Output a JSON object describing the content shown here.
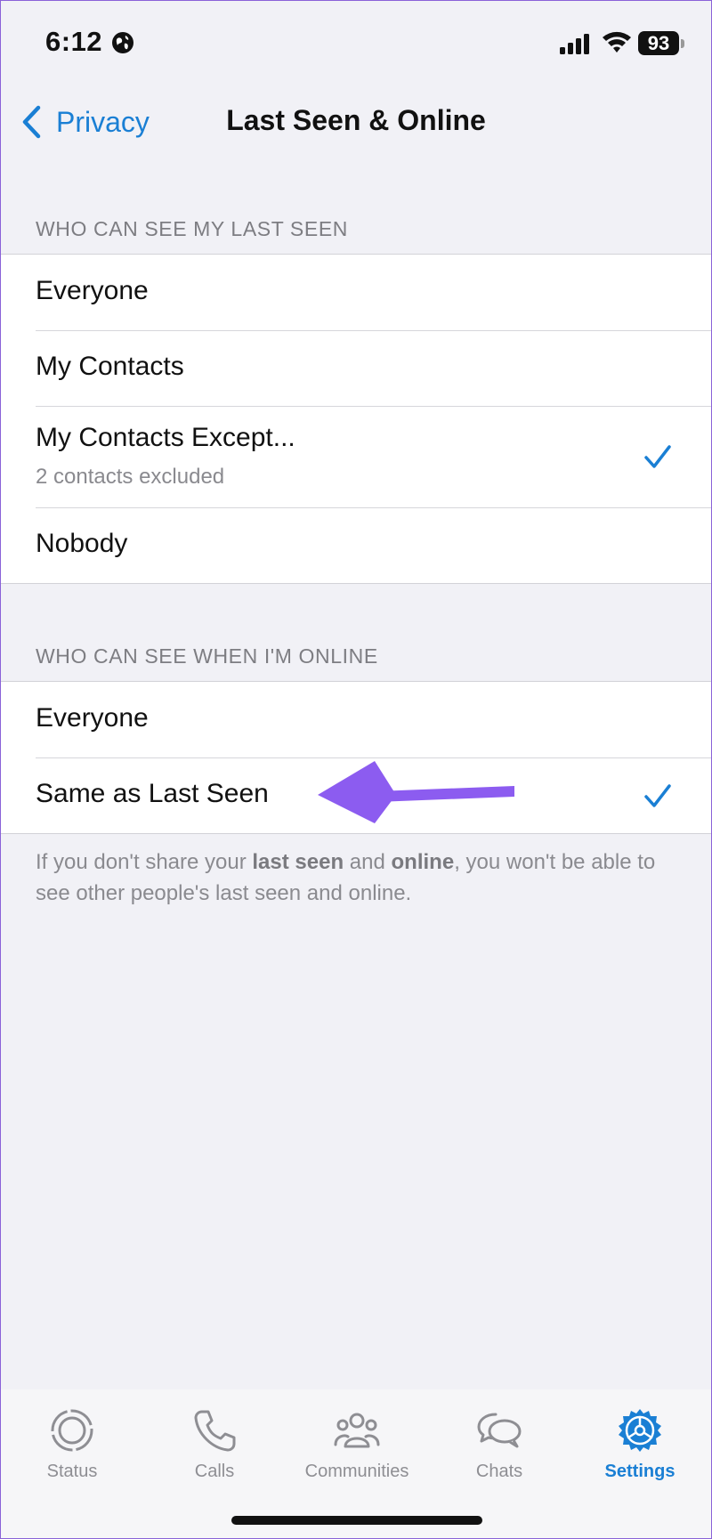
{
  "status_bar": {
    "time": "6:12",
    "battery": "93"
  },
  "nav": {
    "back_label": "Privacy",
    "title": "Last Seen & Online"
  },
  "last_seen": {
    "header": "WHO CAN SEE MY LAST SEEN",
    "options": [
      {
        "label": "Everyone",
        "selected": false
      },
      {
        "label": "My Contacts",
        "selected": false
      },
      {
        "label": "My Contacts Except...",
        "subtitle": "2 contacts excluded",
        "selected": true
      },
      {
        "label": "Nobody",
        "selected": false
      }
    ]
  },
  "online": {
    "header": "WHO CAN SEE WHEN I'M ONLINE",
    "options": [
      {
        "label": "Everyone",
        "selected": false
      },
      {
        "label": "Same as Last Seen",
        "selected": true
      }
    ]
  },
  "footer": {
    "part1": "If you don't share your ",
    "bold1": "last seen",
    "part2": " and ",
    "bold2": "online",
    "part3": ", you won't be able to see other people's last seen and online."
  },
  "tabs": [
    {
      "label": "Status",
      "icon": "status-icon",
      "active": false
    },
    {
      "label": "Calls",
      "icon": "calls-icon",
      "active": false
    },
    {
      "label": "Communities",
      "icon": "communities-icon",
      "active": false
    },
    {
      "label": "Chats",
      "icon": "chats-icon",
      "active": false
    },
    {
      "label": "Settings",
      "icon": "settings-icon",
      "active": true
    }
  ],
  "colors": {
    "accent": "#1a7fd4",
    "annotation_arrow": "#8c5cf0",
    "background": "#f1f1f6"
  }
}
